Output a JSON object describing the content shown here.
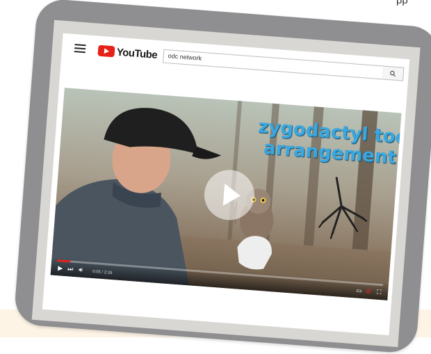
{
  "page_corner_text": "pp",
  "youtube": {
    "brand": "YouTube",
    "search_value": "odc network"
  },
  "video": {
    "overlay_line1": "zygodactyl toe",
    "overlay_line2": "arrangement",
    "time": "0:05 / 2:26",
    "progress": 0.04
  },
  "colors": {
    "tablet_frame": "#8f8f91",
    "youtube_red": "#e62117",
    "overlay_text": "#39a8e0"
  }
}
